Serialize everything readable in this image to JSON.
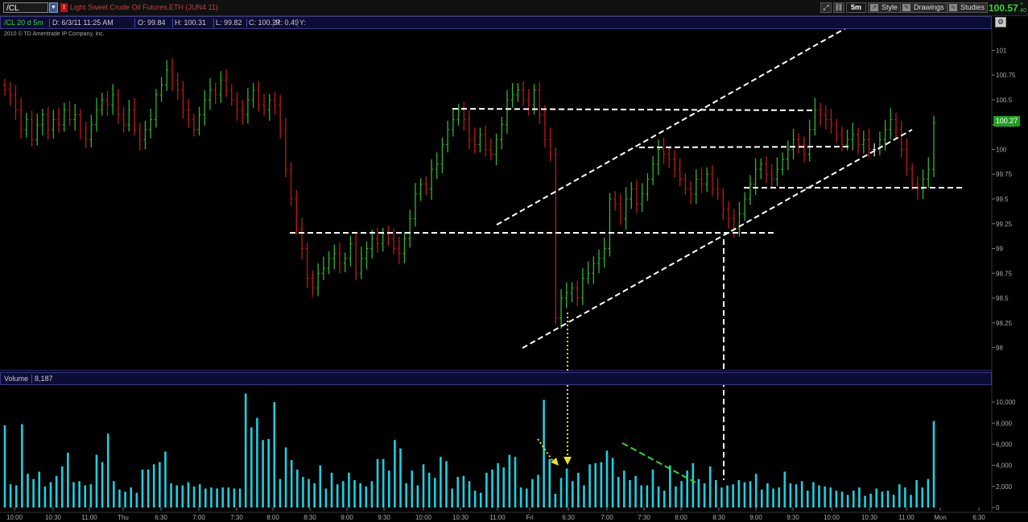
{
  "header": {
    "symbol": "/CL",
    "flag": "!",
    "description": "Light Sweet Crude Oil Futures,ETH (JUN4 11)",
    "timeframe": "5m",
    "style_label": "Style",
    "drawings_label": "Drawings",
    "studies_label": "Studies",
    "last_price": "100.57",
    "last_change_sign": "+",
    "last_change": "40"
  },
  "ohlc": {
    "study": "/CL 20 d 5m",
    "date": "D: 6/3/11 11:25 AM",
    "open": "O: 99.84",
    "high": "H: 100.31",
    "low": "L: 99.82",
    "close": "C: 100.27",
    "range": "R: 0.49",
    "y": "Y:"
  },
  "copyright": "2010 © TD Ameritrade IP Company, Inc.",
  "volume": {
    "label": "Volume",
    "value": "8,187"
  },
  "colors": {
    "up": "#2fb52f",
    "down": "#c01818",
    "neutral": "#e0e0e0",
    "volume": "#19d0e0",
    "annotation_white": "#ffffff",
    "annotation_yellow": "#f0e020",
    "annotation_green": "#2fd52f"
  },
  "chart_data": {
    "type": "ohlc",
    "price_axis": {
      "ticks": [
        "101",
        "100.75",
        "100.5",
        "100.25",
        "100",
        "99.75",
        "99.5",
        "99.25",
        "99",
        "98.75",
        "98.5",
        "98.25",
        "98"
      ],
      "ylim": [
        97.98,
        101.02
      ],
      "last_label": "100.27"
    },
    "volume_axis": {
      "ticks": [
        "10,000",
        "8,000",
        "6,000",
        "4,000",
        "2,000",
        "0"
      ],
      "ylim": [
        0,
        11000
      ]
    },
    "x_ticks": [
      "10:00",
      "10:30",
      "11:00",
      "Thu",
      "6:30",
      "7:00",
      "7:30",
      "8:00",
      "8:30",
      "9:00",
      "9:30",
      "10:00",
      "10:30",
      "11:00",
      "Fri",
      "6:30",
      "7:00",
      "7:30",
      "8:00",
      "8:30",
      "9:00",
      "9:30",
      "10:00",
      "10:30",
      "11:00",
      "Mon",
      "6:30"
    ],
    "bars_close": [
      100.6,
      100.55,
      100.4,
      100.2,
      100.3,
      100.1,
      100.25,
      100.35,
      100.2,
      100.3,
      100.25,
      100.4,
      100.3,
      100.35,
      100.2,
      100.1,
      100.25,
      100.4,
      100.5,
      100.45,
      100.55,
      100.35,
      100.25,
      100.4,
      100.2,
      100.1,
      100.2,
      100.3,
      100.55,
      100.65,
      100.8,
      100.7,
      100.6,
      100.4,
      100.3,
      100.2,
      100.35,
      100.5,
      100.6,
      100.55,
      100.7,
      100.6,
      100.5,
      100.4,
      100.35,
      100.5,
      100.6,
      100.45,
      100.4,
      100.5,
      100.45,
      100.2,
      99.8,
      99.5,
      99.2,
      99.0,
      98.7,
      98.6,
      98.75,
      98.8,
      98.9,
      98.95,
      98.85,
      98.9,
      99.05,
      98.75,
      98.9,
      99.0,
      99.1,
      99.05,
      99.15,
      99.1,
      99.0,
      98.95,
      99.1,
      99.3,
      99.55,
      99.65,
      99.6,
      99.8,
      99.85,
      100.05,
      100.2,
      100.3,
      100.4,
      100.3,
      100.1,
      100.05,
      100.15,
      100.0,
      99.95,
      100.1,
      100.25,
      100.5,
      100.55,
      100.6,
      100.5,
      100.45,
      100.6,
      100.35,
      100.1,
      99.95,
      98.3,
      98.5,
      98.55,
      98.6,
      98.5,
      98.7,
      98.75,
      98.85,
      98.9,
      99.0,
      99.5,
      99.45,
      99.3,
      99.5,
      99.6,
      99.45,
      99.55,
      99.7,
      99.85,
      100.0,
      99.95,
      99.9,
      99.8,
      99.7,
      99.6,
      99.55,
      99.7,
      99.65,
      99.75,
      99.6,
      99.55,
      99.4,
      99.3,
      99.2,
      99.35,
      99.5,
      99.65,
      99.8,
      99.85,
      99.75,
      99.7,
      99.8,
      99.9,
      100.0,
      100.1,
      100.05,
      99.95,
      100.2,
      100.4,
      100.35,
      100.3,
      100.25,
      100.15,
      100.05,
      100.1,
      100.15,
      100.05,
      100.1,
      100.0,
      100.0,
      100.1,
      100.2,
      100.3,
      100.2,
      100.0,
      99.8,
      99.65,
      99.6,
      99.7,
      99.8,
      100.27
    ],
    "volumes": [
      7800,
      2200,
      2100,
      7900,
      3200,
      2700,
      3400,
      2000,
      2400,
      3000,
      3900,
      5200,
      2400,
      2500,
      2100,
      2200,
      5000,
      4300,
      7000,
      2500,
      1700,
      1500,
      1900,
      1400,
      3600,
      3600,
      4100,
      4300,
      5300,
      2300,
      2100,
      2100,
      2400,
      2000,
      2200,
      1800,
      1900,
      1800,
      1900,
      1900,
      1800,
      1800,
      10800,
      7600,
      8500,
      6400,
      6500,
      10000,
      2700,
      5700,
      4500,
      3600,
      2900,
      2700,
      2300,
      4000,
      1800,
      3300,
      2200,
      2500,
      3300,
      2600,
      2300,
      2000,
      2500,
      4600,
      4600,
      3500,
      6400,
      5600,
      2300,
      3500,
      2100,
      4100,
      3300,
      2800,
      4800,
      4400,
      1800,
      2900,
      3000,
      2500,
      1600,
      1400,
      3300,
      3600,
      4200,
      3800,
      5000,
      4800,
      1900,
      1800,
      2700,
      3100,
      10200,
      4600,
      1300,
      2800,
      3700,
      2500,
      3300,
      2100,
      4100,
      4200,
      4300,
      5400,
      4700,
      2900,
      3500,
      2600,
      3000,
      2100,
      2100,
      3600,
      2000,
      1600,
      4000,
      2000,
      2500,
      3500,
      4200,
      2700,
      2300,
      3900,
      2600,
      1900,
      2100,
      2200,
      2600,
      2400,
      2500,
      3200,
      1700,
      2300,
      1800,
      1900,
      3400,
      2300,
      2200,
      2500,
      1600,
      2400,
      2100,
      2000,
      1900,
      1600,
      1500,
      1200,
      1600,
      1900,
      1100,
      1300,
      1800,
      1500,
      1600,
      1200,
      2200,
      1900,
      1200,
      2600,
      1900,
      2700,
      8200
    ],
    "annotations": [
      "upper channel line",
      "lower channel line",
      "horizontal support/resistance levels",
      "yellow dotted arrow to volume",
      "white dashed drop line",
      "green dashed volume trend"
    ]
  }
}
